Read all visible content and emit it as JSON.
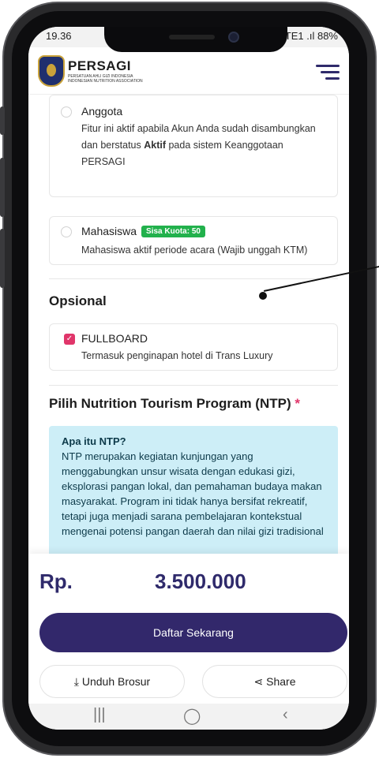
{
  "status": {
    "time": "19.36",
    "indicators": "LTE1 .ıl 88%"
  },
  "header": {
    "brand": "PERSAGI",
    "brand_sub": "Persatuan Ahli Gizi Indonesia Indonesian Nutrition Association"
  },
  "options": {
    "anggota": {
      "title": "Anggota",
      "desc_pre": "Fitur ini aktif apabila Akun Anda sudah disambungkan dan berstatus ",
      "desc_bold": "Aktif",
      "desc_post": " pada sistem Keanggotaan PERSAGI"
    },
    "mahasiswa": {
      "title": "Mahasiswa",
      "badge": "Sisa Kuota: 50",
      "desc": "Mahasiswa aktif periode acara (Wajib unggah KTM)"
    }
  },
  "opsional": {
    "title": "Opsional",
    "item_title": "FULLBOARD",
    "item_desc": "Termasuk penginapan hotel di Trans Luxury"
  },
  "ntp": {
    "title": "Pilih Nutrition Tourism Program (NTP)",
    "required_mark": "*",
    "info_title": "Apa itu NTP?",
    "info_body": "NTP merupakan kegiatan kunjungan yang menggabungkan unsur wisata dengan edukasi gizi, eksplorasi pangan lokal, dan pemahaman budaya makan masyarakat. Program ini tidak hanya bersifat rekreatif, tetapi juga menjadi sarana pembelajaran kontekstual mengenai potensi pangan daerah dan nilai gizi tradisional"
  },
  "footer": {
    "currency": "Rp.",
    "price": "3.500.000",
    "cta": "Daftar Sekarang",
    "download": "Unduh Brosur",
    "share": "Share"
  },
  "icons": {
    "download": "download-icon",
    "share": "share-icon",
    "menu": "hamburger-menu-icon"
  },
  "colors": {
    "primary": "#32286b",
    "accent": "#e0356a",
    "badge": "#22b14c",
    "info_bg": "#cdeef7"
  }
}
